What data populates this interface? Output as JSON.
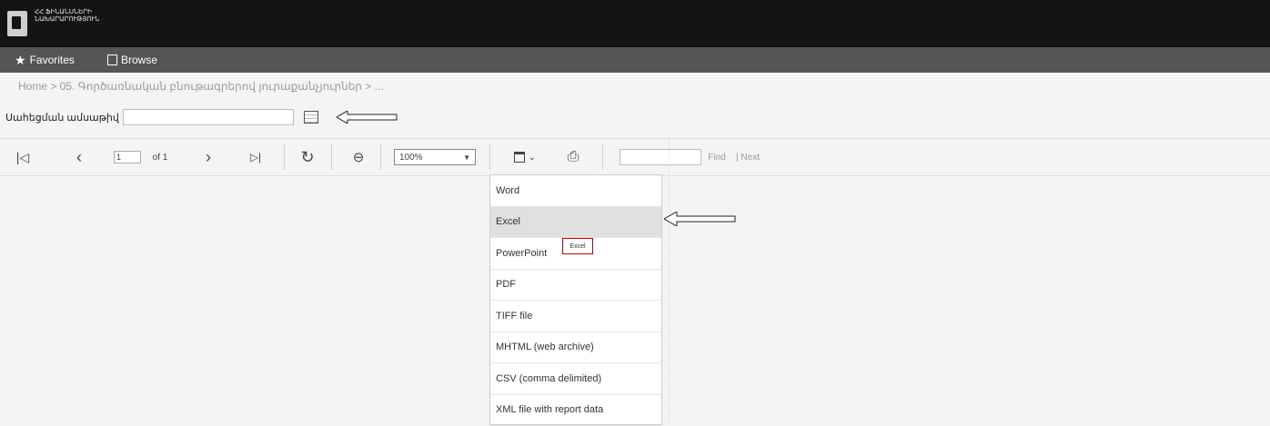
{
  "header": {
    "logo_text": "ՀՀ ՖԻՆԱՆՍՆԵՐԻ ՆԱԽԱՐԱՐՈՒԹՅՈՒՆ"
  },
  "nav": {
    "favorites_label": "Favorites",
    "browse_label": "Browse"
  },
  "breadcrumb": {
    "text": "Home > 05. Գործառնական բնութագրերով յուրաքանչյուրներ > ..."
  },
  "params": {
    "label": "Սահեցման ամսաթիվ",
    "value": ""
  },
  "toolbar": {
    "page_value": "1",
    "page_of": "of 1",
    "zoom_value": "100%",
    "find_label": "Find",
    "next_label": "Next",
    "icons": [
      "first-page-icon",
      "prev-page-icon",
      "next-page-icon",
      "last-page-icon",
      "refresh-icon",
      "back-icon",
      "save-icon",
      "print-icon"
    ]
  },
  "export_menu": {
    "items": [
      "Word",
      "Excel",
      "PowerPoint",
      "PDF",
      "TIFF file",
      "MHTML (web archive)",
      "CSV (comma delimited)",
      "XML file with report data"
    ],
    "highlighted": "Excel",
    "tooltip": "Excel"
  },
  "colors": {
    "topbar": "#141414",
    "navbar": "#555555",
    "highlight": "#e0e0e0",
    "tooltip_border": "#cc0000"
  }
}
